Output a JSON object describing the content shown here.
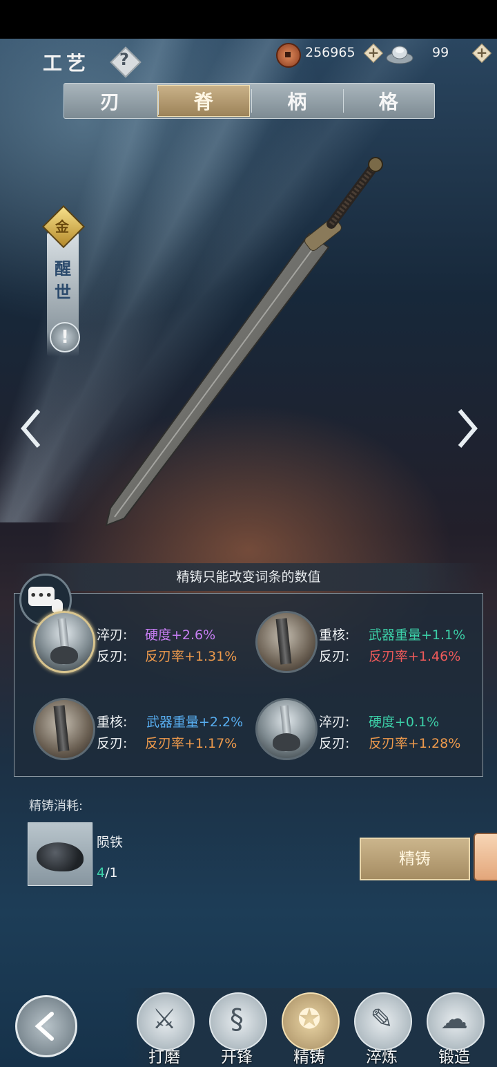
{
  "header": {
    "title": "工艺",
    "help_symbol": "?",
    "copper_value": "256965",
    "silver_value": "99",
    "plus_symbol": "+"
  },
  "tabs": [
    {
      "label": "刃",
      "active": false
    },
    {
      "label": "脊",
      "active": true
    },
    {
      "label": "柄",
      "active": false
    },
    {
      "label": "格",
      "active": false
    }
  ],
  "badge": {
    "grade_char": "金",
    "name_line1": "醒",
    "name_line2": "世",
    "alert_symbol": "!"
  },
  "notice": "精铸只能改变词条的数值",
  "options": [
    {
      "lines": [
        {
          "label": "淬刃:",
          "value": "硬度+2.6%",
          "color": "purple"
        },
        {
          "label": "反刃:",
          "value": "反刃率+1.31%",
          "color": "orange"
        }
      ],
      "selected": true,
      "icon": "stone-blade"
    },
    {
      "lines": [
        {
          "label": "重核:",
          "value": "武器重量+1.1%",
          "color": "teal"
        },
        {
          "label": "反刃:",
          "value": "反刃率+1.46%",
          "color": "red"
        }
      ],
      "selected": false,
      "icon": "iron-core"
    },
    {
      "lines": [
        {
          "label": "重核:",
          "value": "武器重量+2.2%",
          "color": "blue"
        },
        {
          "label": "反刃:",
          "value": "反刃率+1.17%",
          "color": "orange"
        }
      ],
      "selected": false,
      "icon": "iron-core"
    },
    {
      "lines": [
        {
          "label": "淬刃:",
          "value": "硬度+0.1%",
          "color": "teal"
        },
        {
          "label": "反刃:",
          "value": "反刃率+1.28%",
          "color": "orange"
        }
      ],
      "selected": false,
      "icon": "stone-blade"
    }
  ],
  "cost": {
    "label": "精铸消耗:",
    "item_name": "陨铁",
    "have": "4",
    "need": "/1"
  },
  "forge_button": "精铸",
  "bottom_nav": [
    {
      "label": "打磨",
      "icon": "grind-icon",
      "active": false
    },
    {
      "label": "开锋",
      "icon": "sharpen-icon",
      "active": false
    },
    {
      "label": "精铸",
      "icon": "refine-icon",
      "active": true
    },
    {
      "label": "淬炼",
      "icon": "temper-icon",
      "active": false
    },
    {
      "label": "锻造",
      "icon": "forge-lock-icon",
      "active": false
    }
  ],
  "colors": {
    "purple": "#c67ef2",
    "orange": "#ee9a4c",
    "teal": "#3cd0a8",
    "red": "#f05a5a",
    "blue": "#58aef0",
    "gold_button": "#b89f72"
  }
}
